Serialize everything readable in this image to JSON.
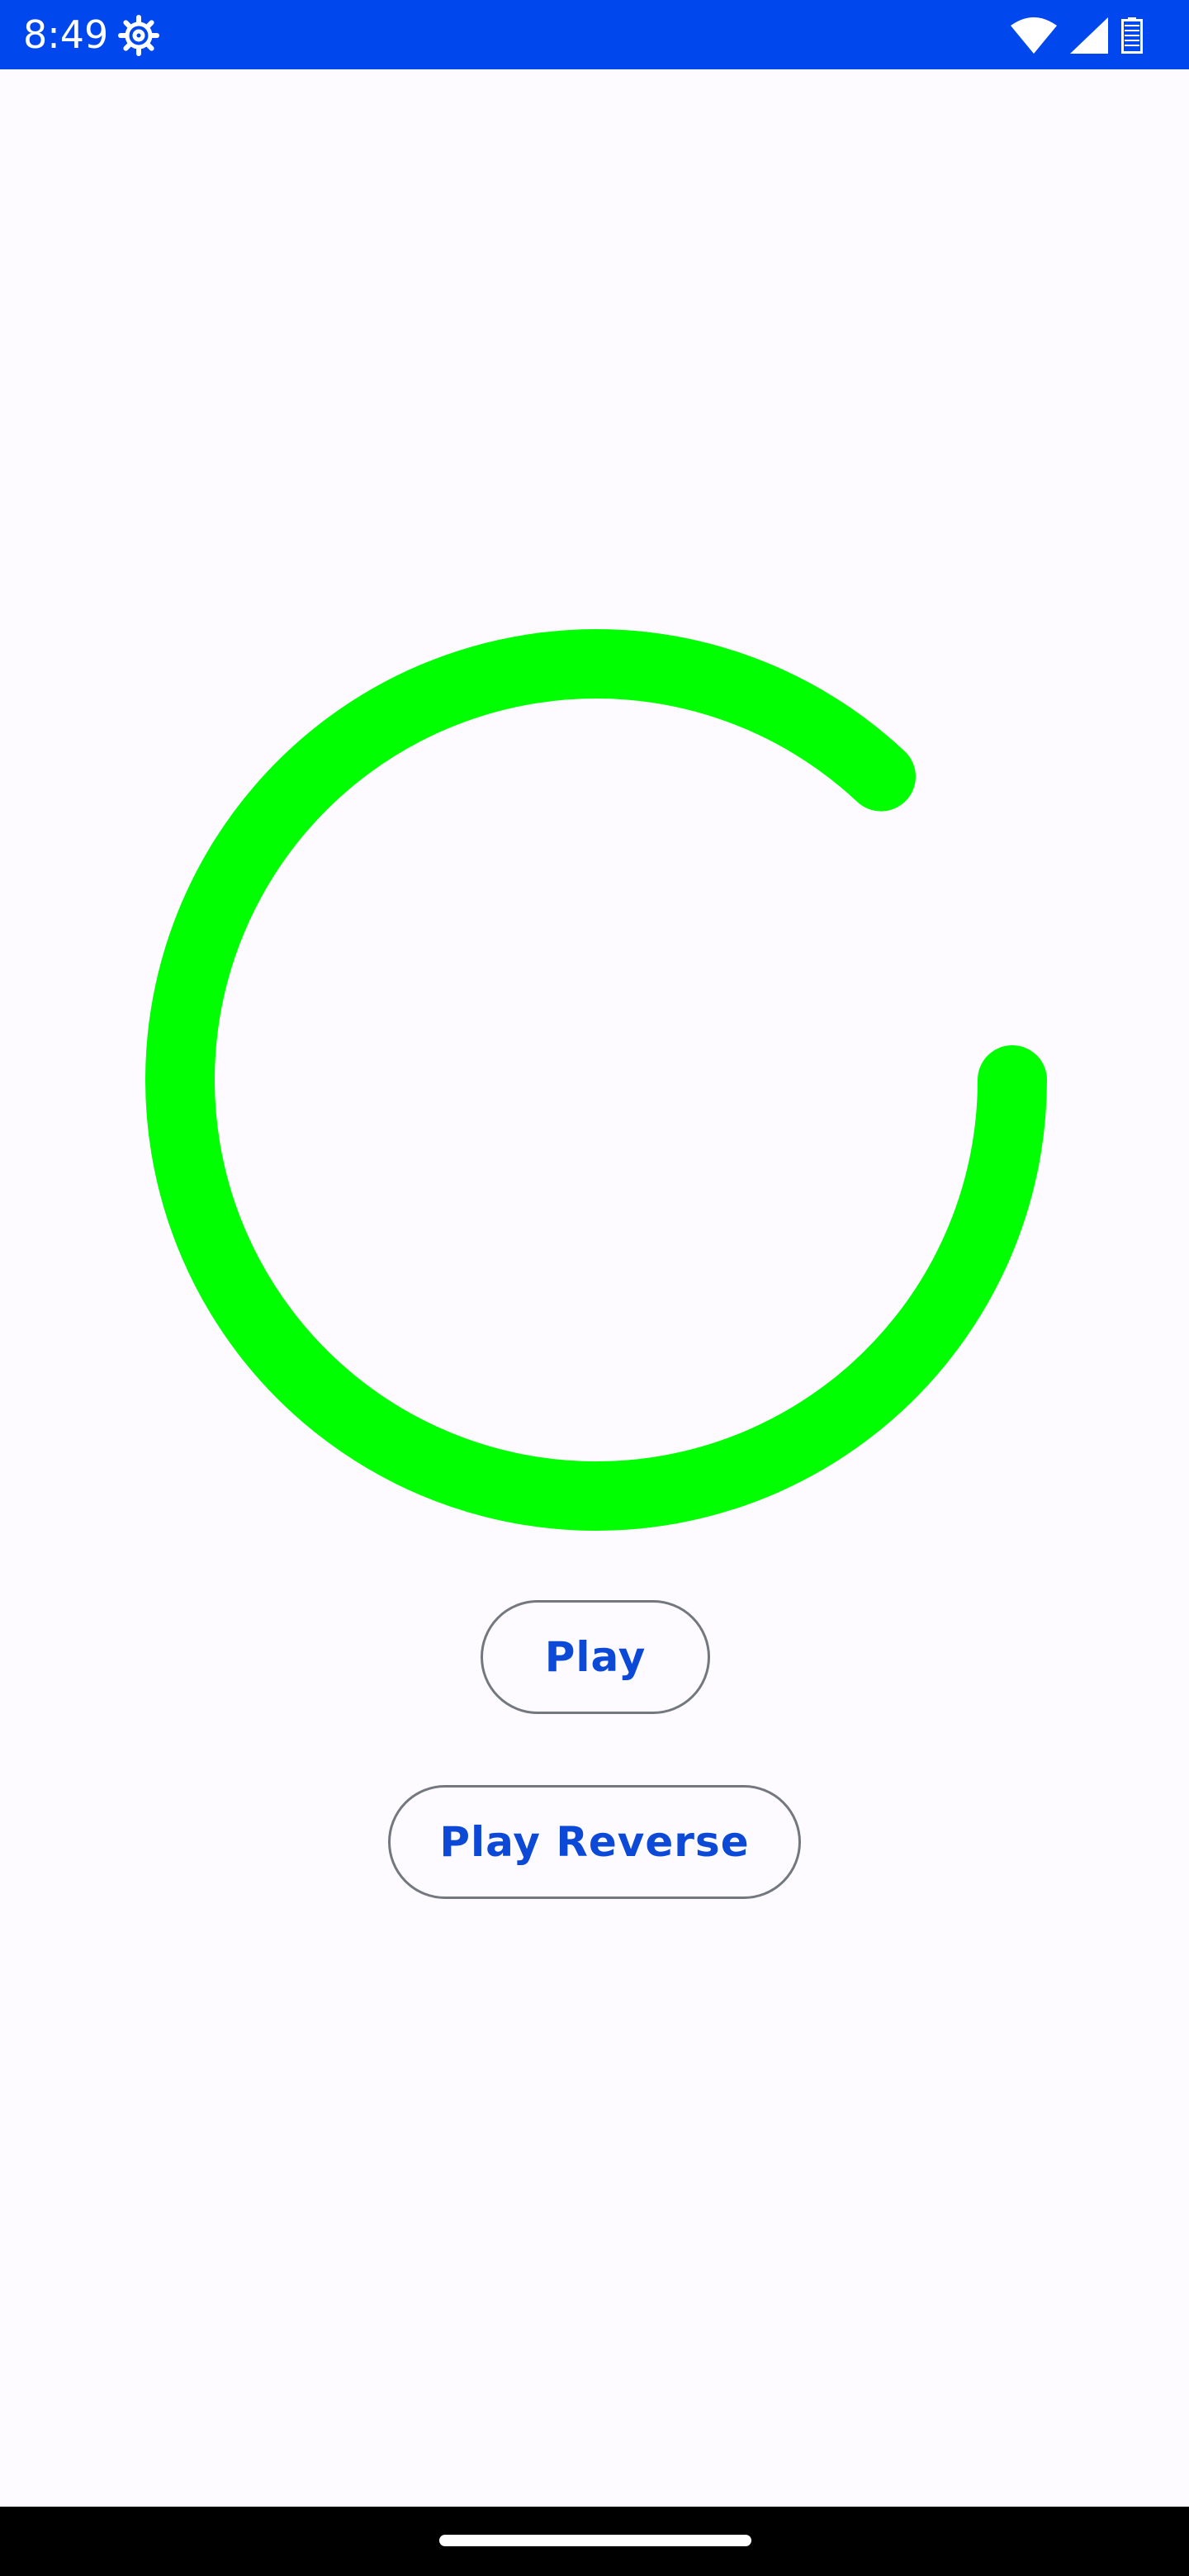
{
  "status_bar": {
    "time": "8:49",
    "background_color": "#0047ED",
    "icons": [
      "settings-icon",
      "wifi-icon",
      "signal-icon",
      "battery-icon"
    ]
  },
  "spinner": {
    "color": "#00FF00",
    "progress_fraction": 0.87
  },
  "buttons": {
    "play_label": "Play",
    "play_reverse_label": "Play Reverse"
  },
  "colors": {
    "background": "#FDFBFF",
    "button_text": "#0C49D6",
    "button_border": "#73777F"
  }
}
